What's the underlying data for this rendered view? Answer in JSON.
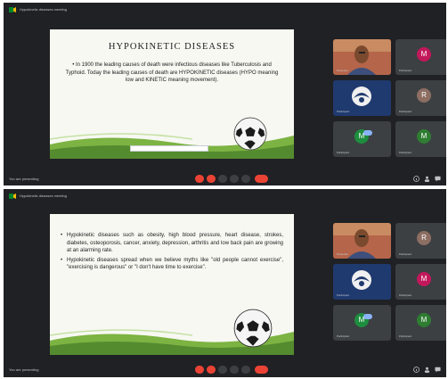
{
  "meeting": {
    "title": "Hypokinetic diseases meeting",
    "self_label": "You are presenting"
  },
  "slide1": {
    "title": "HYPOKINETIC DISEASES",
    "body": "• In 1900 the leading causes of death were infectious diseases like Tuberculosis and Typhoid. Today the leading causes of death are HYPOKINETIC diseases (HYPO meaning low and KINETIC meaning movement)."
  },
  "slide2": {
    "bullets": [
      "Hypokinetic diseases such as obesity, high blood pressure, heart disease, strokes, diabetes, osteoporosis, cancer, anxiety, depression, arthritis and low back pain are growing at an alarming rate.",
      "Hypokinetic diseases spread when we believe myths like \"old people cannot exercise\", \"exercising is dangerous\" or \"I don't have time to exercise\"."
    ]
  },
  "participants1": [
    {
      "initial": "",
      "name": "Presenter",
      "color": "#3b3f44",
      "photo": true
    },
    {
      "initial": "M",
      "name": "Participant",
      "color": "#c2185b"
    },
    {
      "initial": "",
      "name": "Participant",
      "color": "#1f3a6e",
      "logo": true
    },
    {
      "initial": "R",
      "name": "Participant",
      "color": "#8d6e63"
    },
    {
      "initial": "M",
      "name": "Participant",
      "color": "#1e8e3e",
      "badge": true
    },
    {
      "initial": "M",
      "name": "Participant",
      "color": "#2e7d32"
    }
  ],
  "participants2": [
    {
      "initial": "",
      "name": "Presenter",
      "color": "#3b3f44",
      "photo": true
    },
    {
      "initial": "R",
      "name": "Participant",
      "color": "#8d6e63"
    },
    {
      "initial": "",
      "name": "Participant",
      "color": "#1f3a6e",
      "logo": true
    },
    {
      "initial": "M",
      "name": "Participant",
      "color": "#c2185b"
    },
    {
      "initial": "M",
      "name": "Participant",
      "color": "#1e8e3e",
      "badge": true
    },
    {
      "initial": "M",
      "name": "Participant",
      "color": "#2e7d32"
    }
  ],
  "colors": {
    "end_call": "#ea4335",
    "mic_off": "#ea4335",
    "meet_bg": "#202124"
  },
  "icons": [
    "meet-logo-icon",
    "mic-off-icon",
    "camera-off-icon",
    "captions-icon",
    "present-icon",
    "more-icon",
    "end-call-icon",
    "info-icon",
    "people-icon",
    "chat-icon"
  ]
}
